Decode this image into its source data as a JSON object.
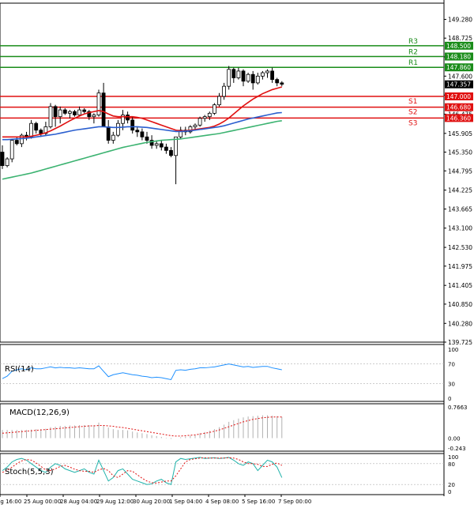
{
  "chart_data": {
    "type": "candlestick",
    "price_axis": {
      "ticks": [
        "149.280",
        "148.725",
        "148.170",
        "147.600",
        "147.040",
        "146.475",
        "145.905",
        "145.350",
        "144.795",
        "144.225",
        "143.665",
        "143.100",
        "142.530",
        "141.975",
        "141.405",
        "140.850",
        "140.280",
        "139.725"
      ],
      "ylim": [
        139.725,
        149.76
      ]
    },
    "time_axis": {
      "labels": [
        "ug 16:00",
        "25 Aug 00:00",
        "28 Aug 04:00",
        "29 Aug 12:00",
        "30 Aug 20:00",
        "1 Sep 04:00",
        "4 Sep 08:00",
        "5 Sep 16:00",
        "7 Sep 00:00"
      ]
    },
    "levels": [
      {
        "name": "R3",
        "value": "148.500",
        "color": "#1a8c1a"
      },
      {
        "name": "R2",
        "value": "148.180",
        "color": "#1a8c1a"
      },
      {
        "name": "R1",
        "value": "147.860",
        "color": "#1a8c1a"
      },
      {
        "name": "S1",
        "value": "147.000",
        "color": "#e01010"
      },
      {
        "name": "S2",
        "value": "146.680",
        "color": "#e01010"
      },
      {
        "name": "S3",
        "value": "146.360",
        "color": "#e01010"
      }
    ],
    "current_price": "147.357",
    "candles": [
      [
        145.35,
        145.55,
        144.85,
        144.95
      ],
      [
        144.95,
        145.2,
        144.9,
        145.15
      ],
      [
        145.15,
        145.75,
        145.05,
        145.7
      ],
      [
        145.7,
        145.8,
        145.55,
        145.6
      ],
      [
        145.6,
        145.9,
        145.5,
        145.85
      ],
      [
        145.85,
        145.95,
        145.7,
        145.8
      ],
      [
        145.8,
        146.3,
        145.75,
        146.2
      ],
      [
        146.2,
        146.25,
        145.9,
        146.0
      ],
      [
        146.0,
        146.05,
        145.8,
        145.9
      ],
      [
        145.9,
        146.25,
        145.85,
        146.1
      ],
      [
        146.1,
        146.8,
        146.05,
        146.7
      ],
      [
        146.7,
        146.75,
        146.1,
        146.4
      ],
      [
        146.4,
        146.7,
        146.2,
        146.6
      ],
      [
        146.6,
        146.65,
        146.45,
        146.5
      ],
      [
        146.5,
        146.6,
        146.35,
        146.55
      ],
      [
        146.55,
        146.6,
        146.4,
        146.45
      ],
      [
        146.45,
        146.7,
        146.4,
        146.6
      ],
      [
        146.6,
        146.65,
        146.5,
        146.55
      ],
      [
        146.55,
        146.6,
        146.3,
        146.4
      ],
      [
        146.4,
        146.5,
        146.2,
        146.45
      ],
      [
        146.45,
        147.2,
        146.4,
        147.1
      ],
      [
        147.1,
        147.4,
        146.5,
        146.1
      ],
      [
        146.1,
        146.3,
        145.6,
        145.7
      ],
      [
        145.7,
        145.95,
        145.6,
        145.85
      ],
      [
        145.85,
        146.3,
        145.8,
        146.2
      ],
      [
        146.2,
        146.6,
        146.0,
        146.45
      ],
      [
        146.45,
        146.55,
        146.2,
        146.3
      ],
      [
        146.3,
        146.4,
        145.9,
        146.0
      ],
      [
        146.0,
        146.1,
        145.8,
        145.95
      ],
      [
        145.95,
        146.05,
        145.7,
        145.8
      ],
      [
        145.8,
        145.95,
        145.6,
        145.7
      ],
      [
        145.7,
        145.85,
        145.45,
        145.55
      ],
      [
        145.55,
        145.7,
        145.45,
        145.6
      ],
      [
        145.6,
        145.7,
        145.4,
        145.5
      ],
      [
        145.5,
        145.6,
        145.3,
        145.4
      ],
      [
        145.4,
        145.5,
        145.2,
        145.25
      ],
      [
        145.25,
        145.55,
        144.4,
        145.8
      ],
      [
        145.8,
        146.1,
        145.75,
        146.0
      ],
      [
        146.0,
        146.1,
        145.85,
        145.95
      ],
      [
        145.95,
        146.15,
        145.9,
        146.1
      ],
      [
        146.1,
        146.2,
        146.0,
        146.15
      ],
      [
        146.15,
        146.4,
        146.1,
        146.35
      ],
      [
        146.35,
        146.45,
        146.25,
        146.4
      ],
      [
        146.4,
        146.55,
        146.3,
        146.5
      ],
      [
        146.5,
        146.8,
        146.45,
        146.75
      ],
      [
        146.75,
        147.1,
        146.7,
        147.0
      ],
      [
        147.0,
        147.4,
        146.9,
        147.3
      ],
      [
        147.3,
        147.9,
        147.2,
        147.8
      ],
      [
        147.8,
        147.85,
        147.4,
        147.55
      ],
      [
        147.55,
        147.85,
        147.5,
        147.75
      ],
      [
        147.75,
        147.8,
        147.3,
        147.45
      ],
      [
        147.45,
        147.7,
        147.4,
        147.65
      ],
      [
        147.65,
        147.75,
        147.2,
        147.4
      ],
      [
        147.4,
        147.7,
        147.35,
        147.6
      ],
      [
        147.6,
        147.75,
        147.5,
        147.7
      ],
      [
        147.7,
        147.8,
        147.55,
        147.75
      ],
      [
        147.75,
        147.85,
        147.4,
        147.5
      ],
      [
        147.5,
        147.55,
        147.3,
        147.4
      ],
      [
        147.4,
        147.45,
        147.3,
        147.36
      ]
    ],
    "ma_lines": [
      {
        "color": "#e01010",
        "values": [
          145.8,
          145.8,
          145.8,
          145.8,
          145.8,
          145.8,
          145.82,
          145.85,
          145.88,
          145.92,
          145.98,
          146.05,
          146.12,
          146.2,
          146.28,
          146.35,
          146.42,
          146.48,
          146.52,
          146.55,
          146.58,
          146.55,
          146.48,
          146.42,
          146.4,
          146.4,
          146.4,
          146.4,
          146.38,
          146.35,
          146.3,
          146.25,
          146.2,
          146.15,
          146.1,
          146.05,
          146.0,
          145.98,
          145.98,
          146.0,
          146.02,
          146.04,
          146.06,
          146.08,
          146.12,
          146.18,
          146.26,
          146.36,
          146.48,
          146.6,
          146.72,
          146.82,
          146.92,
          147.0,
          147.08,
          147.14,
          147.2,
          147.24,
          147.28
        ]
      },
      {
        "color": "#2b5fcf",
        "values": [
          145.72,
          145.72,
          145.73,
          145.74,
          145.75,
          145.76,
          145.78,
          145.8,
          145.82,
          145.84,
          145.86,
          145.88,
          145.91,
          145.94,
          145.97,
          146.0,
          146.02,
          146.04,
          146.06,
          146.08,
          146.1,
          146.1,
          146.09,
          146.08,
          146.08,
          146.09,
          146.1,
          146.1,
          146.1,
          146.09,
          146.08,
          146.06,
          146.04,
          146.02,
          146.0,
          145.98,
          145.96,
          145.96,
          145.97,
          145.98,
          146.0,
          146.02,
          146.04,
          146.06,
          146.08,
          146.1,
          146.13,
          146.17,
          146.21,
          146.25,
          146.29,
          146.33,
          146.36,
          146.39,
          146.42,
          146.45,
          146.48,
          146.51,
          146.52
        ]
      },
      {
        "color": "#3cb371",
        "values": [
          144.55,
          144.58,
          144.61,
          144.64,
          144.67,
          144.7,
          144.73,
          144.77,
          144.81,
          144.85,
          144.89,
          144.93,
          144.97,
          145.01,
          145.05,
          145.09,
          145.13,
          145.17,
          145.21,
          145.25,
          145.29,
          145.33,
          145.37,
          145.41,
          145.45,
          145.49,
          145.52,
          145.55,
          145.58,
          145.61,
          145.64,
          145.66,
          145.68,
          145.7,
          145.71,
          145.72,
          145.73,
          145.74,
          145.76,
          145.78,
          145.8,
          145.82,
          145.84,
          145.86,
          145.88,
          145.9,
          145.93,
          145.96,
          145.99,
          146.02,
          146.05,
          146.08,
          146.11,
          146.14,
          146.17,
          146.2,
          146.23,
          146.26,
          146.28
        ]
      }
    ],
    "rsi": {
      "label": "RSI(14)",
      "ticks": [
        "100",
        "70",
        "30",
        "0"
      ],
      "values": [
        40,
        45,
        55,
        58,
        60,
        58,
        62,
        60,
        60,
        62,
        64,
        62,
        63,
        62,
        62,
        61,
        62,
        61,
        60,
        60,
        66,
        55,
        44,
        48,
        50,
        52,
        50,
        48,
        47,
        45,
        44,
        42,
        43,
        42,
        40,
        38,
        57,
        58,
        57,
        59,
        60,
        62,
        62,
        63,
        64,
        66,
        68,
        70,
        68,
        66,
        64,
        65,
        63,
        64,
        65,
        65,
        62,
        60,
        58
      ]
    },
    "macd": {
      "label": "MACD(12,26,9)",
      "ticks": [
        "0.7663",
        "0.00",
        "-0.243"
      ],
      "ylim": [
        -0.243,
        0.7663
      ],
      "hist": [
        0.2,
        0.2,
        0.2,
        0.2,
        0.2,
        0.2,
        0.21,
        0.22,
        0.22,
        0.23,
        0.27,
        0.28,
        0.3,
        0.3,
        0.31,
        0.31,
        0.32,
        0.32,
        0.32,
        0.32,
        0.38,
        0.32,
        0.26,
        0.22,
        0.2,
        0.2,
        0.19,
        0.16,
        0.14,
        0.12,
        0.1,
        0.07,
        0.05,
        0.03,
        0.01,
        -0.02,
        0.0,
        0.02,
        0.04,
        0.06,
        0.08,
        0.12,
        0.15,
        0.18,
        0.22,
        0.27,
        0.33,
        0.4,
        0.44,
        0.48,
        0.51,
        0.53,
        0.54,
        0.55,
        0.56,
        0.56,
        0.55,
        0.54,
        0.52
      ],
      "signal": [
        0.12,
        0.13,
        0.14,
        0.15,
        0.16,
        0.17,
        0.18,
        0.19,
        0.2,
        0.21,
        0.22,
        0.23,
        0.24,
        0.25,
        0.26,
        0.27,
        0.28,
        0.29,
        0.3,
        0.3,
        0.31,
        0.31,
        0.3,
        0.29,
        0.27,
        0.26,
        0.24,
        0.22,
        0.2,
        0.18,
        0.16,
        0.14,
        0.12,
        0.1,
        0.08,
        0.06,
        0.05,
        0.05,
        0.06,
        0.07,
        0.08,
        0.1,
        0.12,
        0.14,
        0.17,
        0.2,
        0.24,
        0.28,
        0.32,
        0.36,
        0.4,
        0.43,
        0.46,
        0.48,
        0.5,
        0.51,
        0.52,
        0.52,
        0.52
      ]
    },
    "stoch": {
      "label": "Stoch(5,5,3)",
      "ticks": [
        "100",
        "80",
        "20",
        "0"
      ],
      "k": [
        60,
        70,
        85,
        92,
        95,
        90,
        80,
        70,
        60,
        55,
        70,
        80,
        75,
        65,
        60,
        55,
        60,
        65,
        55,
        50,
        90,
        60,
        30,
        40,
        60,
        65,
        50,
        35,
        30,
        25,
        20,
        22,
        30,
        35,
        25,
        20,
        85,
        95,
        92,
        94,
        96,
        98,
        95,
        96,
        97,
        95,
        96,
        98,
        90,
        80,
        75,
        85,
        80,
        60,
        75,
        90,
        85,
        70,
        40
      ],
      "d": [
        55,
        60,
        70,
        80,
        88,
        92,
        90,
        82,
        72,
        62,
        60,
        65,
        72,
        75,
        70,
        64,
        60,
        58,
        58,
        55,
        62,
        66,
        60,
        45,
        40,
        50,
        60,
        58,
        48,
        38,
        30,
        25,
        24,
        27,
        30,
        30,
        45,
        65,
        85,
        92,
        94,
        96,
        97,
        96,
        96,
        96,
        96,
        97,
        96,
        92,
        85,
        80,
        80,
        78,
        72,
        72,
        78,
        82,
        75
      ]
    }
  }
}
